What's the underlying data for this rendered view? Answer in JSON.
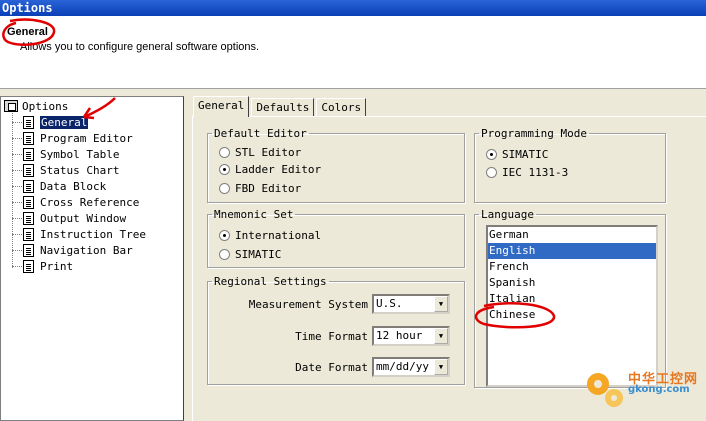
{
  "window": {
    "title": "Options"
  },
  "header": {
    "title": "General",
    "description": "Allows you to configure general software options."
  },
  "tree": {
    "root": "Options",
    "items": [
      {
        "label": "General",
        "selected": true
      },
      {
        "label": "Program Editor"
      },
      {
        "label": "Symbol Table"
      },
      {
        "label": "Status Chart"
      },
      {
        "label": "Data Block"
      },
      {
        "label": "Cross Reference"
      },
      {
        "label": "Output Window"
      },
      {
        "label": "Instruction Tree"
      },
      {
        "label": "Navigation Bar"
      },
      {
        "label": "Print"
      }
    ]
  },
  "tabs": [
    {
      "label": "General"
    },
    {
      "label": "Defaults"
    },
    {
      "label": "Colors"
    }
  ],
  "default_editor": {
    "legend": "Default Editor",
    "options": [
      "STL Editor",
      "Ladder Editor",
      "FBD Editor"
    ],
    "selected": "Ladder Editor"
  },
  "mnemonic_set": {
    "legend": "Mnemonic Set",
    "options": [
      "International",
      "SIMATIC"
    ],
    "selected": "International"
  },
  "regional": {
    "legend": "Regional Settings",
    "measurement_label": "Measurement System",
    "measurement_value": "U.S.",
    "time_label": "Time Format",
    "time_value": "12 hour",
    "date_label": "Date Format",
    "date_value": "mm/dd/yy"
  },
  "programming_mode": {
    "legend": "Programming Mode",
    "options": [
      "SIMATIC",
      "IEC 1131-3"
    ],
    "selected": "SIMATIC"
  },
  "language": {
    "legend": "Language",
    "items": [
      "German",
      "English",
      "French",
      "Spanish",
      "Italian",
      "Chinese"
    ],
    "selected": "English"
  },
  "watermark": {
    "cn": "中华工控网",
    "url": "gkong.com"
  },
  "colors": {
    "title_bar": "#0a3fb6",
    "selection": "#316ac5",
    "annotation": "#e00000"
  }
}
